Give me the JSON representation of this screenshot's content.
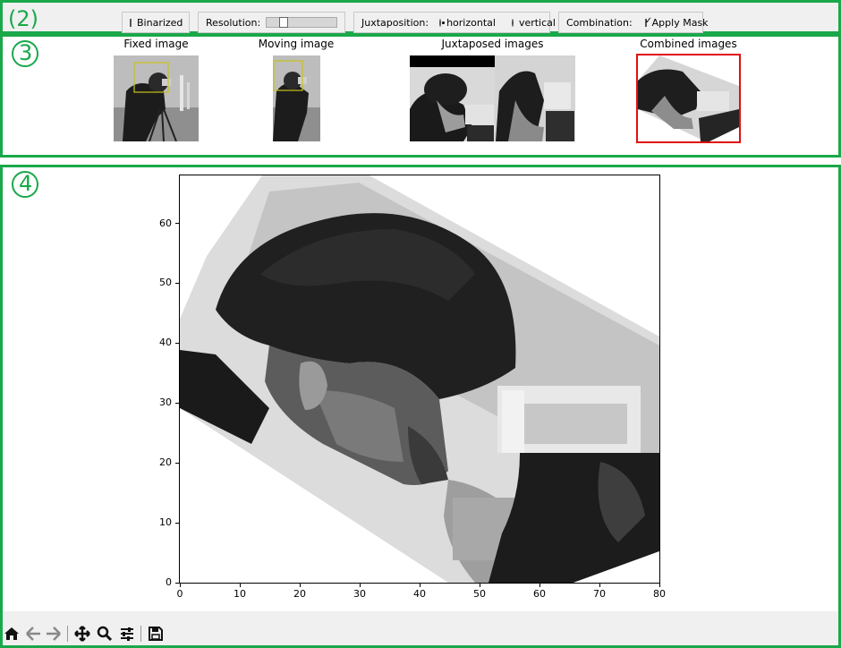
{
  "panels": {
    "controls_num": "2",
    "thumbs_num": "3",
    "main_num": "4"
  },
  "controls": {
    "binarized_label": "Binarized",
    "binarized_checked": false,
    "resolution_label": "Resolution:",
    "resolution_level": 0.3,
    "juxtaposition_label": "Juxtaposition:",
    "horizontal_label": "horizontal",
    "vertical_label": "vertical",
    "juxtaposition_selected": "horizontal",
    "combination_label": "Combination:",
    "apply_mask_label": "Apply Mask",
    "apply_mask_checked": true
  },
  "thumbnails": {
    "fixed_title": "Fixed image",
    "moving_title": "Moving image",
    "juxtaposed_title": "Juxtaposed images",
    "combined_title": "Combined images"
  },
  "chart_data": {
    "type": "heatmap",
    "title": "",
    "xlabel": "",
    "ylabel": "",
    "xlim": [
      0,
      80
    ],
    "ylim": [
      0,
      68
    ],
    "xticks": [
      "0",
      "10",
      "20",
      "30",
      "40",
      "50",
      "60",
      "70",
      "80"
    ],
    "yticks": [
      "0",
      "10",
      "20",
      "30",
      "40",
      "50",
      "60"
    ],
    "colormap": "gray"
  },
  "toolbar": {
    "home_icon": "home-icon",
    "back_icon": "arrow-left-icon",
    "forward_icon": "arrow-right-icon",
    "pan_icon": "pan-icon",
    "zoom_icon": "zoom-icon",
    "configure_icon": "sliders-icon",
    "save_icon": "save-icon"
  },
  "colors": {
    "accent": "#1aa84a",
    "selection": "#e01010",
    "roi_box": "#c9c21a"
  }
}
